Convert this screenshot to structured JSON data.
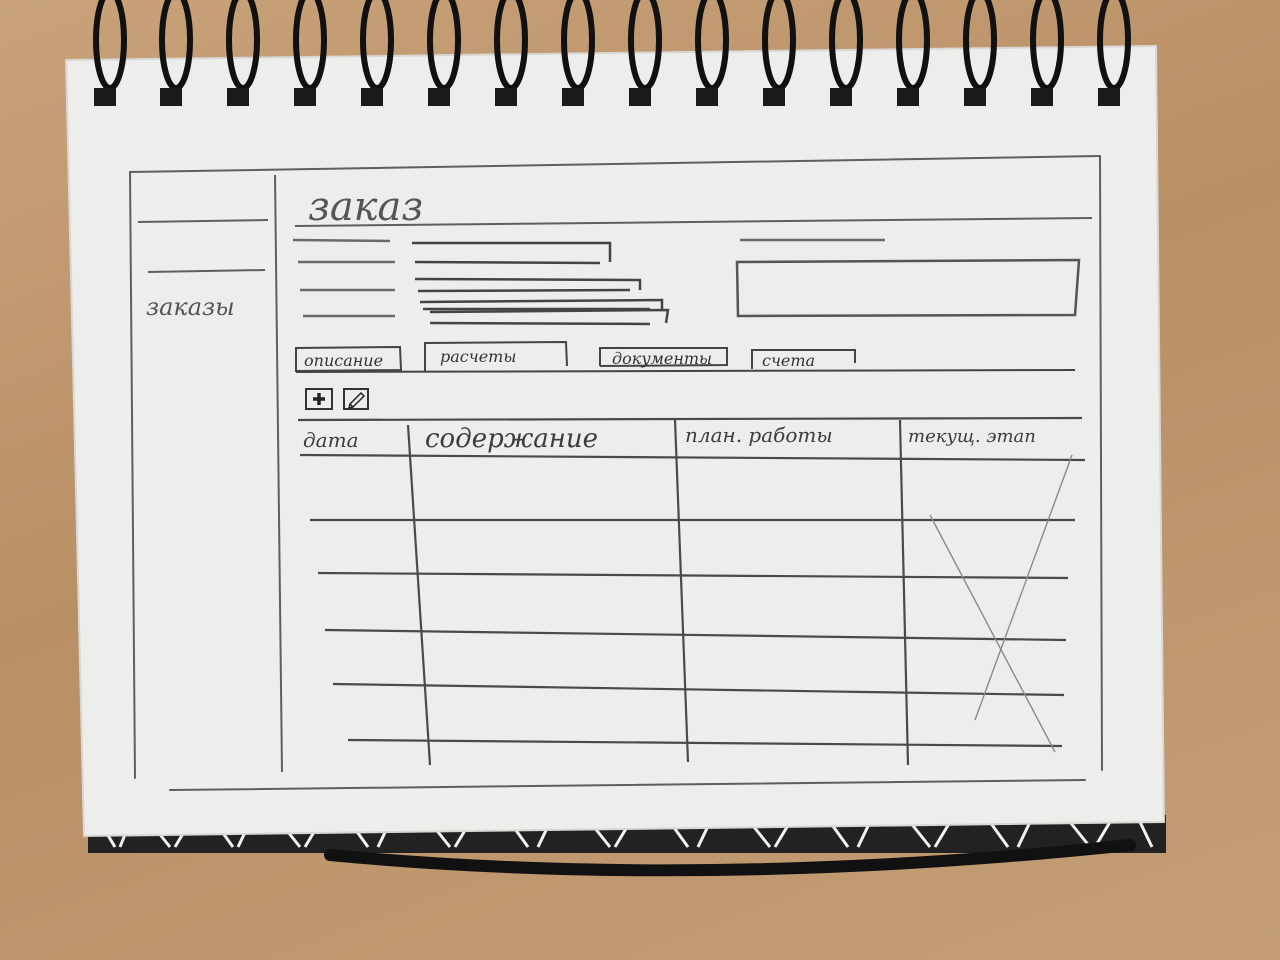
{
  "sidebar": {
    "items": [
      {
        "label": "заказы",
        "active": true
      }
    ]
  },
  "header": {
    "title": "заказ"
  },
  "tabs": [
    {
      "label": "описание",
      "active": false
    },
    {
      "label": "расчеты",
      "active": true
    },
    {
      "label": "документы",
      "active": false
    },
    {
      "label": "счета",
      "active": false
    }
  ],
  "toolbar": {
    "buttons": [
      {
        "name": "add-button",
        "icon": "plus-icon"
      },
      {
        "name": "edit-button",
        "icon": "pencil-icon"
      }
    ]
  },
  "table": {
    "columns": [
      "дата",
      "содержание",
      "план. работы",
      "текущ. этап"
    ],
    "rows": [
      [
        "",
        "",
        "",
        ""
      ],
      [
        "",
        "",
        "",
        ""
      ],
      [
        "",
        "",
        "",
        ""
      ],
      [
        "",
        "",
        "",
        ""
      ],
      [
        "",
        "",
        "",
        ""
      ],
      [
        "",
        "",
        "",
        ""
      ]
    ]
  }
}
